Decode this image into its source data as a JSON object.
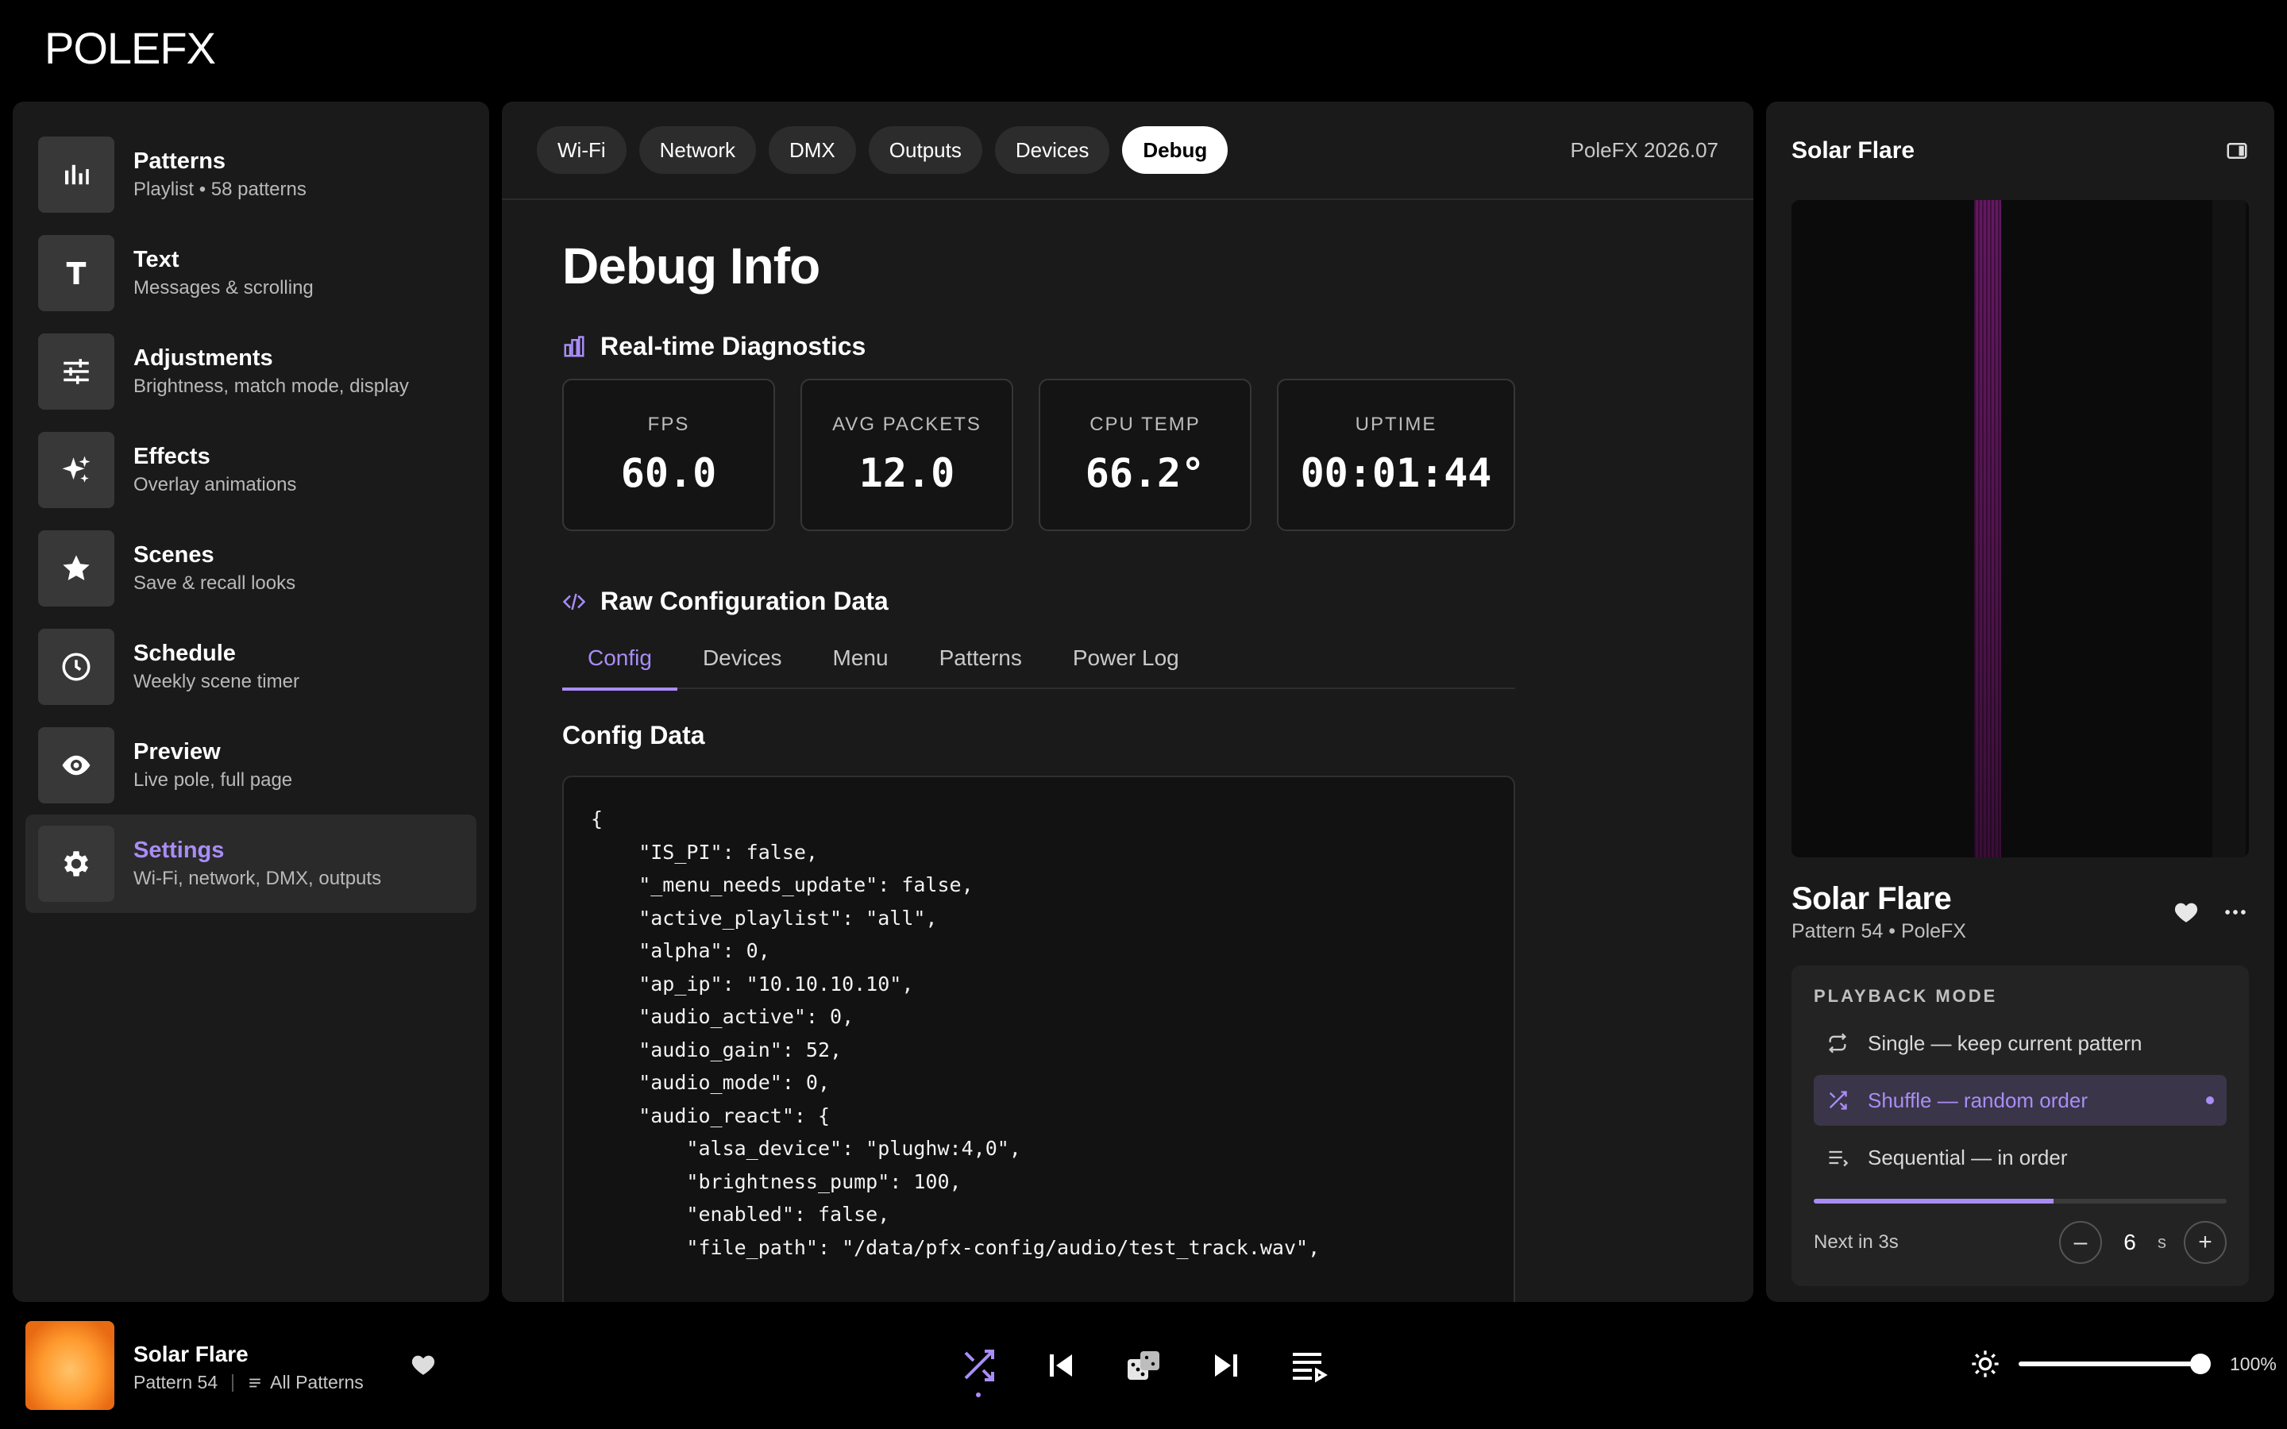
{
  "app": {
    "logo_text": "POLEFX"
  },
  "sidebar": {
    "items": [
      {
        "title": "Patterns",
        "subtitle": "Playlist • 58 patterns",
        "icon": "bar-chart-icon"
      },
      {
        "title": "Text",
        "subtitle": "Messages & scrolling",
        "icon": "text-icon"
      },
      {
        "title": "Adjustments",
        "subtitle": "Brightness, match mode, display",
        "icon": "sliders-icon"
      },
      {
        "title": "Effects",
        "subtitle": "Overlay animations",
        "icon": "sparkle-icon"
      },
      {
        "title": "Scenes",
        "subtitle": "Save & recall looks",
        "icon": "star-icon"
      },
      {
        "title": "Schedule",
        "subtitle": "Weekly scene timer",
        "icon": "clock-icon"
      },
      {
        "title": "Preview",
        "subtitle": "Live pole, full page",
        "icon": "eye-icon"
      },
      {
        "title": "Settings",
        "subtitle": "Wi-Fi, network, DMX, outputs",
        "icon": "gear-icon",
        "active": true
      }
    ]
  },
  "topbar": {
    "tabs": [
      "Wi-Fi",
      "Network",
      "DMX",
      "Outputs",
      "Devices",
      "Debug"
    ],
    "active_tab": "Debug",
    "version": "PoleFX 2026.07"
  },
  "main": {
    "title": "Debug Info",
    "diagnostics_title": "Real-time Diagnostics",
    "stats": [
      {
        "label": "FPS",
        "value": "60.0"
      },
      {
        "label": "AVG PACKETS",
        "value": "12.0"
      },
      {
        "label": "CPU TEMP",
        "value": "66.2°"
      },
      {
        "label": "UPTIME",
        "value": "00:01:44"
      }
    ],
    "raw_title": "Raw Configuration Data",
    "subtabs": [
      "Config",
      "Devices",
      "Menu",
      "Patterns",
      "Power Log"
    ],
    "active_subtab": "Config",
    "config_title": "Config Data",
    "config_json": "{\n    \"IS_PI\": false,\n    \"_menu_needs_update\": false,\n    \"active_playlist\": \"all\",\n    \"alpha\": 0,\n    \"ap_ip\": \"10.10.10.10\",\n    \"audio_active\": 0,\n    \"audio_gain\": 52,\n    \"audio_mode\": 0,\n    \"audio_react\": {\n        \"alsa_device\": \"plughw:4,0\",\n        \"brightness_pump\": 100,\n        \"enabled\": false,\n        \"file_path\": \"/data/pfx-config/audio/test_track.wav\","
  },
  "right": {
    "header_title": "Solar Flare",
    "track_title": "Solar Flare",
    "track_subtitle": "Pattern 54 • PoleFX",
    "playback_label": "PLAYBACK MODE",
    "options": [
      {
        "label": "Single — keep current pattern",
        "icon": "repeat-icon"
      },
      {
        "label": "Shuffle — random order",
        "icon": "shuffle-icon",
        "active": true
      },
      {
        "label": "Sequential — in order",
        "icon": "list-icon"
      }
    ],
    "progress": 0.58,
    "next_text": "Next in 3s",
    "stepper_value": "6",
    "stepper_unit": "s"
  },
  "player": {
    "title": "Solar Flare",
    "pattern": "Pattern 54",
    "playlist": "All Patterns",
    "volume": "100%",
    "volume_level": 1.0
  },
  "colors": {
    "accent": "#a98df6",
    "panel": "#1a1a1a",
    "background": "#000000"
  }
}
